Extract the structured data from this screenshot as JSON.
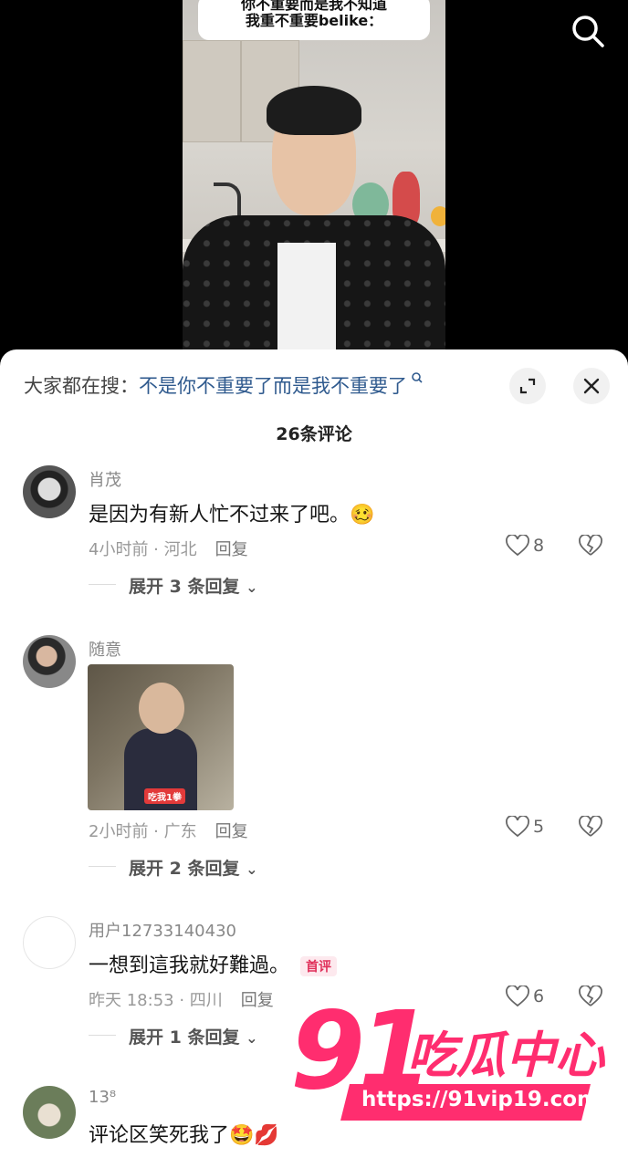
{
  "video": {
    "caption_line1": "你不重要而是我不知道",
    "caption_line2": "我重不重要belike："
  },
  "sheet": {
    "hot_search_prefix": "大家都在搜：",
    "hot_search_link": "不是你不重要了而是我不重要了",
    "comment_count": "26条评论"
  },
  "comments": [
    {
      "username": "肖茂",
      "text": "是因为有新人忙不过来了吧。",
      "emoji": "🥴",
      "time_location": "4小时前 · 河北",
      "reply_label": "回复",
      "likes": "8",
      "expand_label": "展开 3 条回复"
    },
    {
      "username": "随意",
      "image_label": "吃我1拳",
      "time_location": "2小时前 · 广东",
      "reply_label": "回复",
      "likes": "5",
      "expand_label": "展开 2 条回复"
    },
    {
      "username": "用户12733140430",
      "text": "一想到這我就好難過。",
      "badge": "首评",
      "time_location": "昨天 18:53 · 四川",
      "reply_label": "回复",
      "likes": "6",
      "expand_label": "展开 1 条回复"
    },
    {
      "username": "13⁸",
      "text": "评论区笑死我了",
      "emoji": "🤩💋"
    }
  ],
  "watermark": {
    "number": "91",
    "name": "吃瓜中心",
    "url": "https://91vip19.com"
  },
  "colors": {
    "link": "#2f5a8e",
    "watermark": "#ff2d6f",
    "badge": "#e0305a"
  }
}
